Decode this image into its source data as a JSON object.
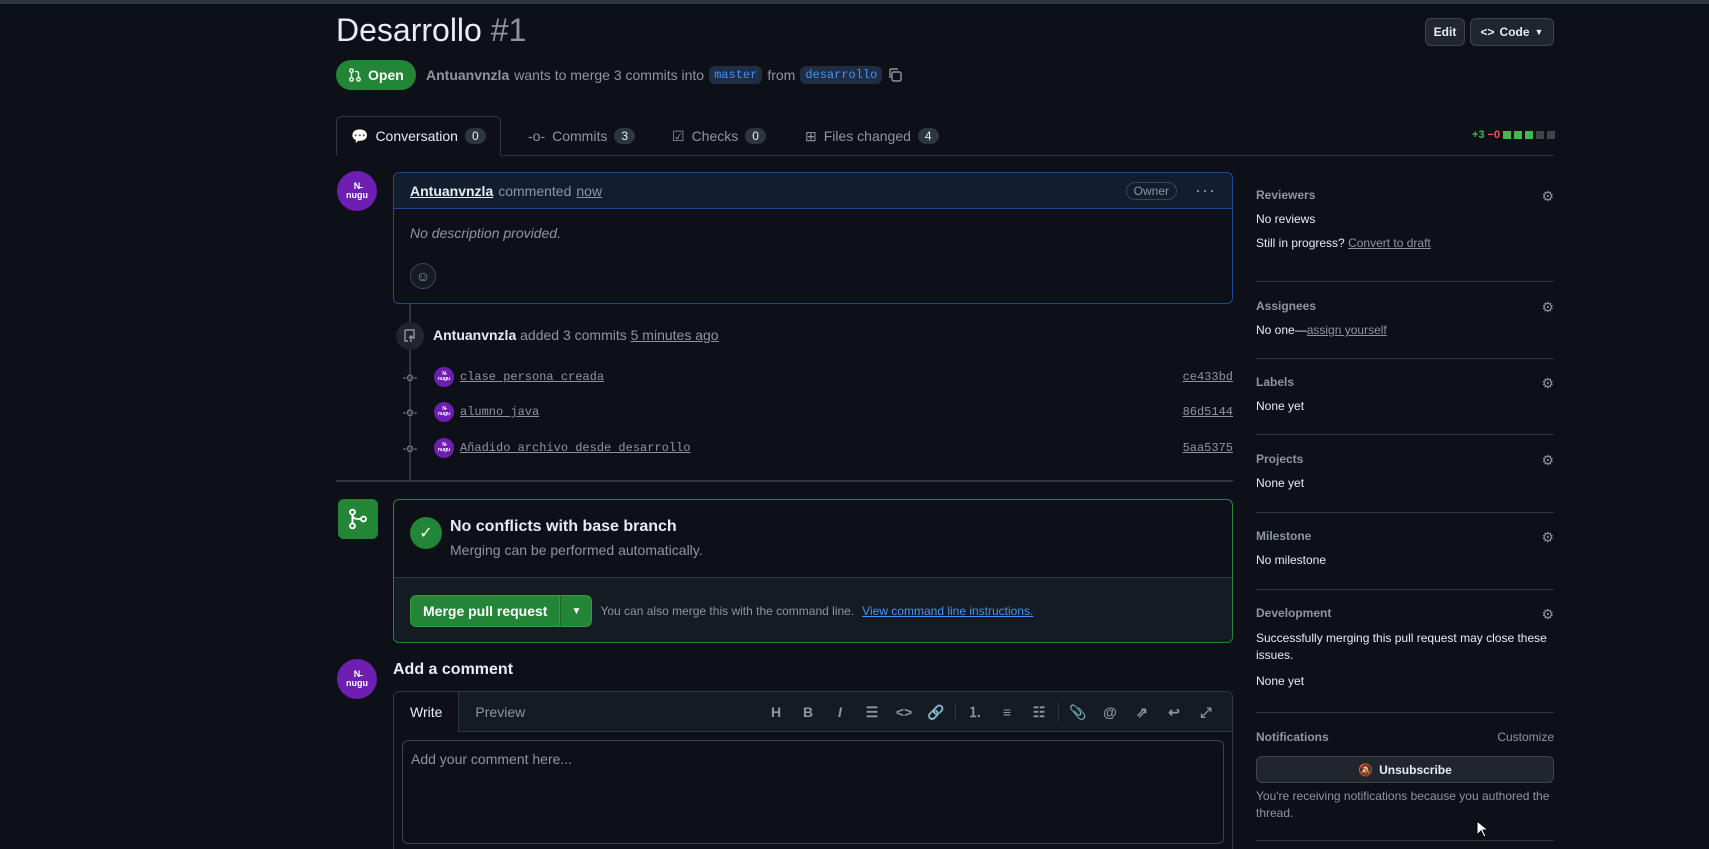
{
  "pr": {
    "title": "Desarrollo",
    "number": "#1",
    "state": "Open",
    "author": "Antuanvnzla",
    "merge_text": "wants to merge 3 commits into",
    "base_branch": "master",
    "from_text": "from",
    "head_branch": "desarrollo"
  },
  "header": {
    "edit_label": "Edit",
    "code_label": "Code"
  },
  "tabs": [
    {
      "label": "Conversation",
      "count": "0"
    },
    {
      "label": "Commits",
      "count": "3"
    },
    {
      "label": "Checks",
      "count": "0"
    },
    {
      "label": "Files changed",
      "count": "4"
    }
  ],
  "diffstat": {
    "additions": "+3",
    "deletions": "−0"
  },
  "comment": {
    "author": "Antuanvnzla",
    "action": "commented",
    "time": "now",
    "role": "Owner",
    "body": "No description provided.",
    "avatar_text_1": "Ν̶",
    "avatar_text_2": "nugu"
  },
  "event": {
    "author": "Antuanvnzla",
    "action": "added 3 commits",
    "time": "5 minutes ago"
  },
  "commits": [
    {
      "message": "clase persona creada",
      "sha": "ce433bd"
    },
    {
      "message": "alumno java",
      "sha": "86d5144"
    },
    {
      "message": "Añadido archivo desde desarrollo",
      "sha": "5aa5375"
    }
  ],
  "merge": {
    "title": "No conflicts with base branch",
    "subtitle": "Merging can be performed automatically.",
    "button_label": "Merge pull request",
    "hint": "You can also merge this with the command line.",
    "link": "View command line instructions."
  },
  "add_comment": {
    "title": "Add a comment",
    "tab_write": "Write",
    "tab_preview": "Preview",
    "placeholder": "Add your comment here...",
    "toolbar_heading": "H",
    "toolbar_bold": "B",
    "toolbar_italic": "I"
  },
  "sidebar": {
    "reviewers_title": "Reviewers",
    "reviewers_value": "No reviews",
    "draft_text": "Still in progress?",
    "draft_link": "Convert to draft",
    "assignees_title": "Assignees",
    "assignees_value": "No one—",
    "assignees_link": "assign yourself",
    "labels_title": "Labels",
    "labels_value": "None yet",
    "projects_title": "Projects",
    "projects_value": "None yet",
    "milestone_title": "Milestone",
    "milestone_value": "No milestone",
    "development_title": "Development",
    "development_desc": "Successfully merging this pull request may close these issues.",
    "development_value": "None yet",
    "notifications_title": "Notifications",
    "notifications_customize": "Customize",
    "unsubscribe_label": "Unsubscribe",
    "notifications_reason": "You're receiving notifications because you authored the thread."
  },
  "colors": {
    "accent_green": "#238636",
    "link_blue": "#4493f8",
    "comment_border": "#1f4a8f"
  }
}
